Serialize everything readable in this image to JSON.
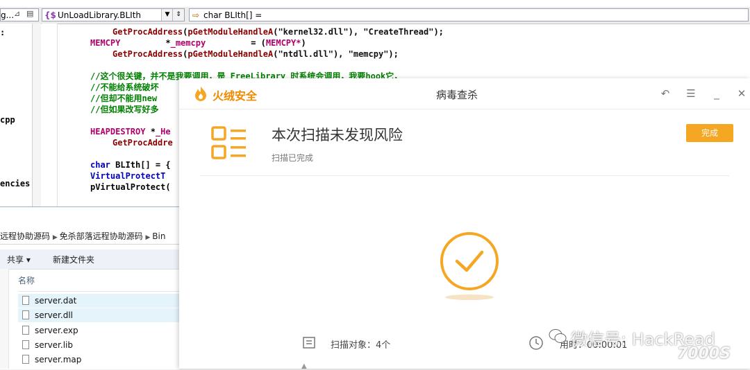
{
  "ide": {
    "left_combo": "g...",
    "class_combo": "UnLoadLibrary.BLIth",
    "member_combo": "char BLIth[] =",
    "left_panel_items": [
      ":",
      "cpp",
      "encies"
    ],
    "code_lines": [
      {
        "indent": "    ",
        "parts": [
          {
            "c": "fn",
            "t": "GetProcAddress"
          },
          {
            "c": "pl",
            "t": "("
          },
          {
            "c": "fn",
            "t": "pGetModuleHandleA"
          },
          {
            "c": "pl",
            "t": "("
          },
          {
            "c": "st",
            "t": "\"kernel32.dll\""
          },
          {
            "c": "pl",
            "t": "), "
          },
          {
            "c": "st",
            "t": "\"CreateThread\""
          },
          {
            "c": "pl",
            "t": ");"
          }
        ]
      },
      {
        "indent": "",
        "parts": [
          {
            "c": "ty",
            "t": "MEMCPY"
          },
          {
            "c": "pl",
            "t": "         *"
          },
          {
            "c": "ty",
            "t": "_memcpy"
          },
          {
            "c": "pl",
            "t": "         = ("
          },
          {
            "c": "ty",
            "t": "MEMCPY*"
          },
          {
            "c": "pl",
            "t": ")"
          }
        ]
      },
      {
        "indent": "    ",
        "parts": [
          {
            "c": "fn",
            "t": "GetProcAddress"
          },
          {
            "c": "pl",
            "t": "("
          },
          {
            "c": "fn",
            "t": "pGetModuleHandleA"
          },
          {
            "c": "pl",
            "t": "("
          },
          {
            "c": "st",
            "t": "\"ntdll.dll\""
          },
          {
            "c": "pl",
            "t": "), "
          },
          {
            "c": "st",
            "t": "\"memcpy\""
          },
          {
            "c": "pl",
            "t": ");"
          }
        ]
      },
      {
        "indent": "",
        "parts": []
      },
      {
        "indent": "",
        "parts": [
          {
            "c": "cm",
            "t": "//这个很关键，并不是我要调用，是 FreeLibrary 时系统会调用，我要hook它，"
          }
        ]
      },
      {
        "indent": "",
        "parts": [
          {
            "c": "cm",
            "t": "//不能给系统破坏"
          }
        ]
      },
      {
        "indent": "",
        "parts": [
          {
            "c": "cm",
            "t": "//但却不能用new"
          }
        ]
      },
      {
        "indent": "",
        "parts": [
          {
            "c": "cm",
            "t": "//但如果改写好多"
          }
        ]
      },
      {
        "indent": "",
        "parts": []
      },
      {
        "indent": "",
        "parts": [
          {
            "c": "ty",
            "t": "HEAPDESTROY"
          },
          {
            "c": "pl",
            "t": " *"
          },
          {
            "c": "ty",
            "t": "_He"
          }
        ]
      },
      {
        "indent": "    ",
        "parts": [
          {
            "c": "fn",
            "t": "GetProcAddre"
          }
        ]
      },
      {
        "indent": "",
        "parts": []
      },
      {
        "indent": "",
        "parts": [
          {
            "c": "kw",
            "t": "char"
          },
          {
            "c": "pl",
            "t": " BLIth[] = {"
          }
        ]
      },
      {
        "indent": "",
        "parts": [
          {
            "c": "kw",
            "t": "VirtualProtectT"
          }
        ]
      },
      {
        "indent": "",
        "parts": [
          {
            "c": "pl",
            "t": "pVirtualProtect("
          }
        ]
      }
    ]
  },
  "explorer": {
    "breadcrumb": [
      "远程协助源码",
      "免杀部落远程协助源码",
      "Bin"
    ],
    "share_label": "共享 ▾",
    "new_folder_label": "新建文件夹",
    "column_name": "名称",
    "files": [
      "server.dat",
      "server.dll",
      "server.exp",
      "server.lib",
      "server.map"
    ]
  },
  "antivirus": {
    "brand": "火绒安全",
    "window_title": "病毒查杀",
    "result_title": "本次扫描未发现风险",
    "result_subtitle": "扫描已完成",
    "done_button": "完成",
    "stat_objects": "扫描对象：4个",
    "stat_time": "用时：00:00:01",
    "accent_color": "#f5a623"
  },
  "watermark": {
    "text": "微信号: HackRead",
    "site": "7000S"
  }
}
